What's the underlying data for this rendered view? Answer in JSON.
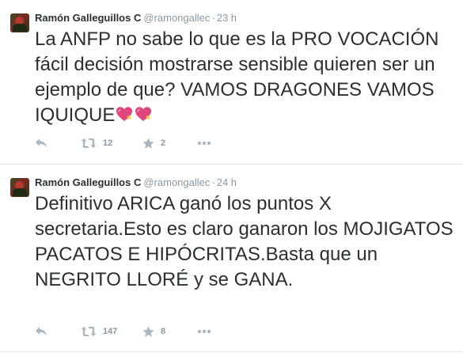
{
  "tweets": [
    {
      "name": "Ramón Galleguillos C",
      "handle": "@ramongallec",
      "dot": "·",
      "time": "23 h",
      "text": "La ANFP no sabe lo que es la PRO VOCACIÓN fácil decisión mostrarse sensible quieren ser un ejemplo de que? VAMOS DRAGONES VAMOS IQUIQUE",
      "emoji": [
        "sparkling-heart-icon",
        "sparkling-heart-icon"
      ],
      "retweets": "12",
      "favorites": "2"
    },
    {
      "name": "Ramón Galleguillos C",
      "handle": "@ramongallec",
      "dot": "·",
      "time": "24 h",
      "text": "Definitivo ARICA ganó los puntos X secretaria.Esto es claro ganaron los MOJIGATOS PACATOS E HIPÓCRITAS.Basta que un NEGRITO LLORÉ y se GANA.",
      "retweets": "147",
      "favorites": "8"
    }
  ],
  "colors": {
    "text": "#292f33",
    "muted": "#8899a6",
    "icon": "#aab8c2",
    "divider": "#e1e8ed",
    "heart": "#e0457b"
  },
  "icons": [
    "reply-icon",
    "retweet-icon",
    "favorite-star-icon",
    "more-dots-icon"
  ]
}
